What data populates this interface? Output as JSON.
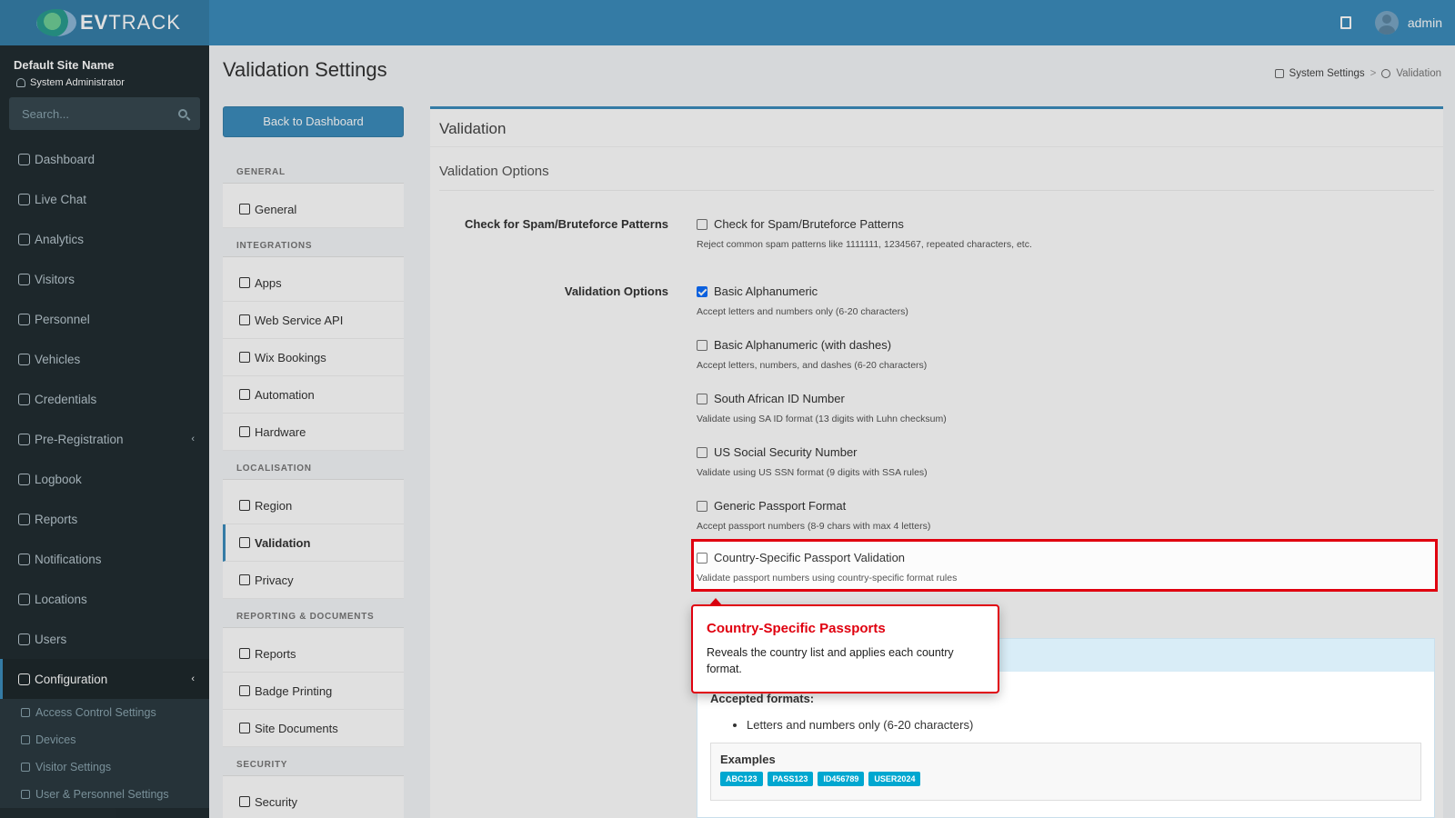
{
  "brand": {
    "name_bold": "EV",
    "name_rest": "TRACK"
  },
  "topbar": {
    "user": "admin"
  },
  "sidebar": {
    "site_name": "Default Site Name",
    "role": "System Administrator",
    "search_placeholder": "Search...",
    "items": [
      {
        "label": "Dashboard",
        "icon": "dashboard-icon"
      },
      {
        "label": "Live Chat",
        "icon": "headset-icon"
      },
      {
        "label": "Analytics",
        "icon": "analytics-icon"
      },
      {
        "label": "Visitors",
        "icon": "eye-icon"
      },
      {
        "label": "Personnel",
        "icon": "user-tie-icon"
      },
      {
        "label": "Vehicles",
        "icon": "car-icon"
      },
      {
        "label": "Credentials",
        "icon": "id-card-icon"
      },
      {
        "label": "Pre-Registration",
        "icon": "exchange-icon"
      },
      {
        "label": "Logbook",
        "icon": "book-icon"
      },
      {
        "label": "Reports",
        "icon": "chart-icon"
      },
      {
        "label": "Notifications",
        "icon": "bell-icon"
      },
      {
        "label": "Locations",
        "icon": "map-icon"
      },
      {
        "label": "Users",
        "icon": "users-icon"
      },
      {
        "label": "Configuration",
        "icon": "cog-icon"
      }
    ],
    "sub_items": [
      {
        "label": "Access Control Settings",
        "icon": "lock-icon"
      },
      {
        "label": "Devices",
        "icon": "cog-icon"
      },
      {
        "label": "Visitor Settings",
        "icon": "eye-icon"
      },
      {
        "label": "User & Personnel Settings",
        "icon": "users-icon"
      }
    ]
  },
  "page": {
    "title": "Validation Settings",
    "breadcrumb": [
      "System Settings",
      ">",
      "Validation"
    ],
    "back_button": "Back to Dashboard"
  },
  "settings_menu": {
    "general_header": "GENERAL",
    "general": "General",
    "integrations_header": "INTEGRATIONS",
    "apps": "Apps",
    "web_service_api": "Web Service API",
    "wix_bookings": "Wix Bookings",
    "automation": "Automation",
    "hardware": "Hardware",
    "localisation_header": "LOCALISATION",
    "region": "Region",
    "validation": "Validation",
    "privacy": "Privacy",
    "reporting_header": "REPORTING & DOCUMENTS",
    "reports": "Reports",
    "badge_printing": "Badge Printing",
    "site_documents": "Site Documents",
    "security_header": "SECURITY",
    "security": "Security"
  },
  "box": {
    "title": "Validation",
    "subtitle": "Validation Options",
    "spam_label": "Check for Spam/Bruteforce Patterns",
    "spam_option": "Check for Spam/Bruteforce Patterns",
    "spam_help": "Reject common spam patterns like 1111111, 1234567, repeated characters, etc.",
    "options_label": "Validation Options",
    "options": [
      {
        "label": "Basic Alphanumeric",
        "help": "Accept letters and numbers only (6-20 characters)",
        "checked": true
      },
      {
        "label": "Basic Alphanumeric (with dashes)",
        "help": "Accept letters, numbers, and dashes (6-20 characters)",
        "checked": false
      },
      {
        "label": "South African ID Number",
        "help": "Validate using SA ID format (13 digits with Luhn checksum)",
        "checked": false
      },
      {
        "label": "US Social Security Number",
        "help": "Validate using US SSN format (9 digits with SSA rules)",
        "checked": false
      },
      {
        "label": "Generic Passport Format",
        "help": "Accept passport numbers (8-9 chars with max 4 letters)",
        "checked": false
      },
      {
        "label": "Country-Specific Passport Validation",
        "help": "Validate passport numbers using country-specific format rules",
        "checked": false
      }
    ],
    "accepted_title": "Accepted formats:",
    "accepted_items": [
      "Letters and numbers only (6-20 characters)"
    ],
    "examples_title": "Examples",
    "examples": [
      "ABC123",
      "PASS123",
      "ID456789",
      "USER2024"
    ]
  },
  "callout": {
    "title": "Country-Specific Passports",
    "text": "Reveals the country list and applies each country format."
  },
  "colors": {
    "primary": "#3c8dbc",
    "sidebar": "#222d32",
    "highlight": "#e0000f",
    "tag": "#00a7d0"
  }
}
